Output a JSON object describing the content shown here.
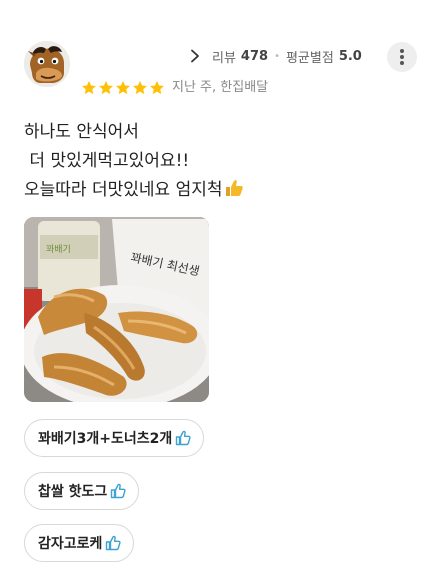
{
  "header": {
    "review_label": "리뷰",
    "review_count": "478",
    "rating_label": "평균별점",
    "rating_value": "5.0"
  },
  "rating": {
    "stars": 5,
    "max": 5,
    "star_color": "#ffc107"
  },
  "meta": "지난 주, 한집배달",
  "review_lines": [
    "하나도 안식어서",
    " 더 맛있게먹고있어요!!",
    "오늘따라 더맛있네요 엄지척"
  ],
  "photo": {
    "cup_text": "꽈배기",
    "bag_text": "꽈배기 최선생"
  },
  "menu_chips": [
    {
      "label": "꽈배기3개+도너츠2개",
      "icon": "thumbs-up-icon"
    },
    {
      "label": "찹쌀 핫도그",
      "icon": "thumbs-up-icon"
    },
    {
      "label": "감자고로케",
      "icon": "thumbs-up-icon"
    }
  ],
  "colors": {
    "accent_blue": "#3fa2d0",
    "star": "#ffc107",
    "thumb_emoji": "#f5b829"
  }
}
